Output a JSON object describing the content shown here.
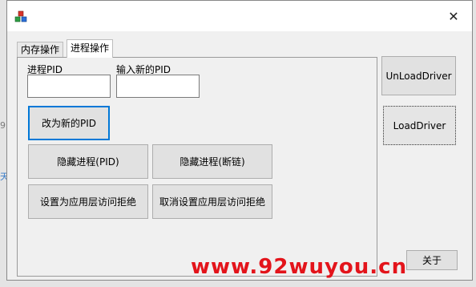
{
  "background": {
    "left_glyphs": [
      "9",
      "天"
    ]
  },
  "window": {
    "close_symbol": "✕",
    "app_icon": "cubes-icon"
  },
  "tabs": [
    {
      "label": "内存操作",
      "active": false
    },
    {
      "label": "进程操作",
      "active": true
    }
  ],
  "process_panel": {
    "pid_label": "进程PID",
    "pid_value": "",
    "new_pid_label": "输入新的PID",
    "new_pid_value": "",
    "change_pid_button": "改为新的PID",
    "hide_process_pid_button": "隐藏进程(PID)",
    "hide_process_unlink_button": "隐藏进程(断链)",
    "deny_access_button": "设置为应用层访问拒绝",
    "cancel_deny_access_button": "取消设置应用层访问拒绝"
  },
  "side_buttons": {
    "unload_driver": "UnLoadDriver",
    "load_driver": "LoadDriver",
    "about": "关于"
  },
  "watermark": "www.92wuyou.cn",
  "colors": {
    "accent": "#0078d7",
    "watermark": "#e3141b"
  }
}
